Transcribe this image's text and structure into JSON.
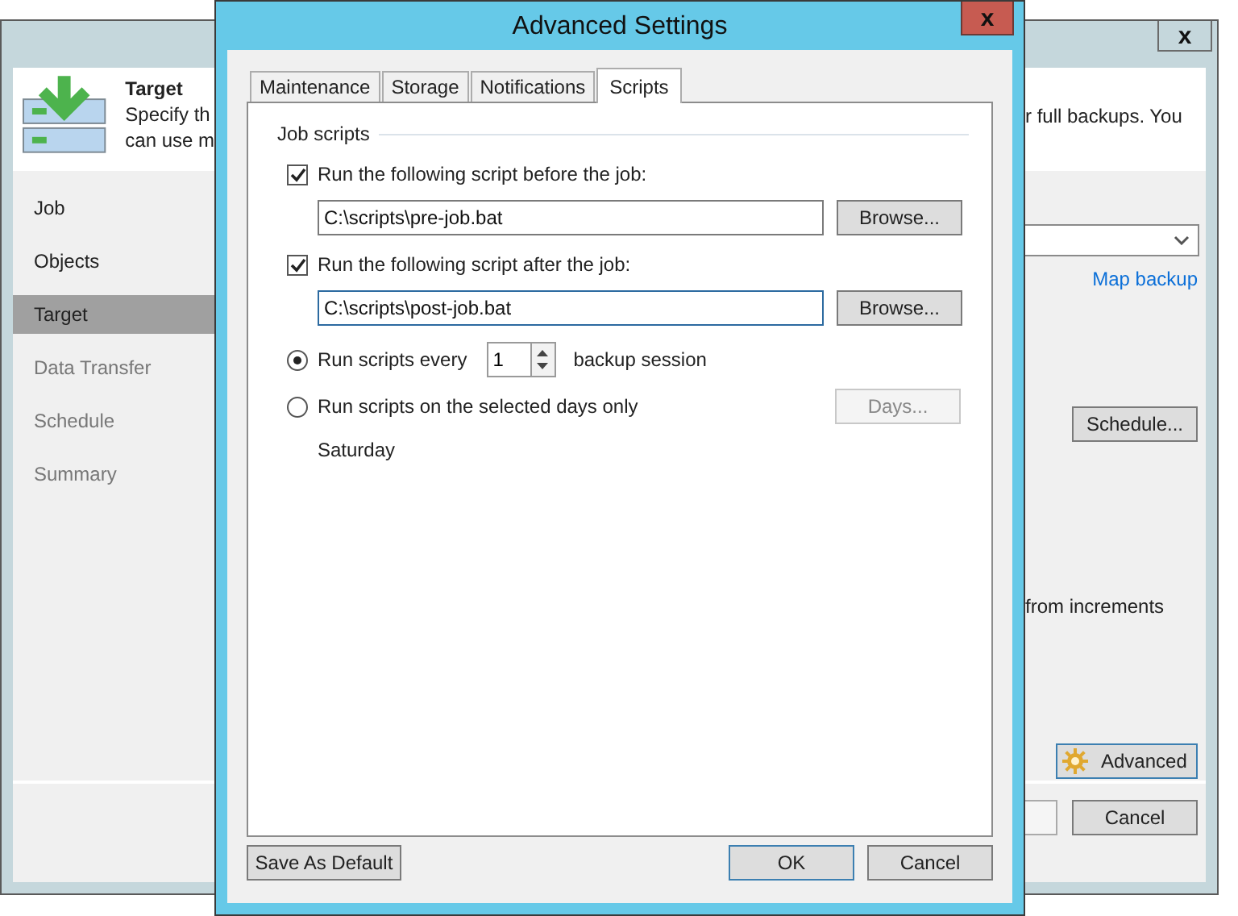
{
  "background_window": {
    "close_label": "x",
    "header": {
      "title": "Target",
      "description_left": [
        "Specify th",
        "can use m"
      ],
      "description_right": "r full backups. You"
    },
    "steps": [
      {
        "label": "Job",
        "selected": false,
        "disabled": false
      },
      {
        "label": "Objects",
        "selected": false,
        "disabled": false
      },
      {
        "label": "Target",
        "selected": true,
        "disabled": false
      },
      {
        "label": "Data Transfer",
        "selected": false,
        "disabled": true
      },
      {
        "label": "Schedule",
        "selected": false,
        "disabled": true
      },
      {
        "label": "Summary",
        "selected": false,
        "disabled": true
      }
    ],
    "map_link": "Map backup",
    "schedule_button": "Schedule...",
    "increments_text": "from increments",
    "advanced_button": "Advanced",
    "cancel_button": "Cancel"
  },
  "dialog": {
    "title": "Advanced Settings",
    "close_label": "x",
    "tabs": [
      {
        "label": "Maintenance",
        "selected": false
      },
      {
        "label": "Storage",
        "selected": false
      },
      {
        "label": "Notifications",
        "selected": false
      },
      {
        "label": "Scripts",
        "selected": true
      }
    ],
    "group_label": "Job scripts",
    "scripts": [
      {
        "label": "Run the following script before the job:",
        "checked": true,
        "path": "C:\\scripts\\pre-job.bat",
        "focused": false,
        "browse": "Browse..."
      },
      {
        "label": "Run the following script after the job:",
        "checked": true,
        "path": "C:\\scripts\\post-job.bat",
        "focused": true,
        "browse": "Browse..."
      }
    ],
    "schedule_options": [
      {
        "kind": "every",
        "label": "Run scripts every",
        "selected": true,
        "count": "1",
        "suffix": "backup session"
      },
      {
        "kind": "days",
        "label": "Run scripts on the selected days only",
        "selected": false,
        "button": "Days...",
        "button_disabled": true,
        "days": "Saturday"
      }
    ],
    "buttons": {
      "save_default": "Save As Default",
      "ok": "OK",
      "cancel": "Cancel"
    }
  }
}
